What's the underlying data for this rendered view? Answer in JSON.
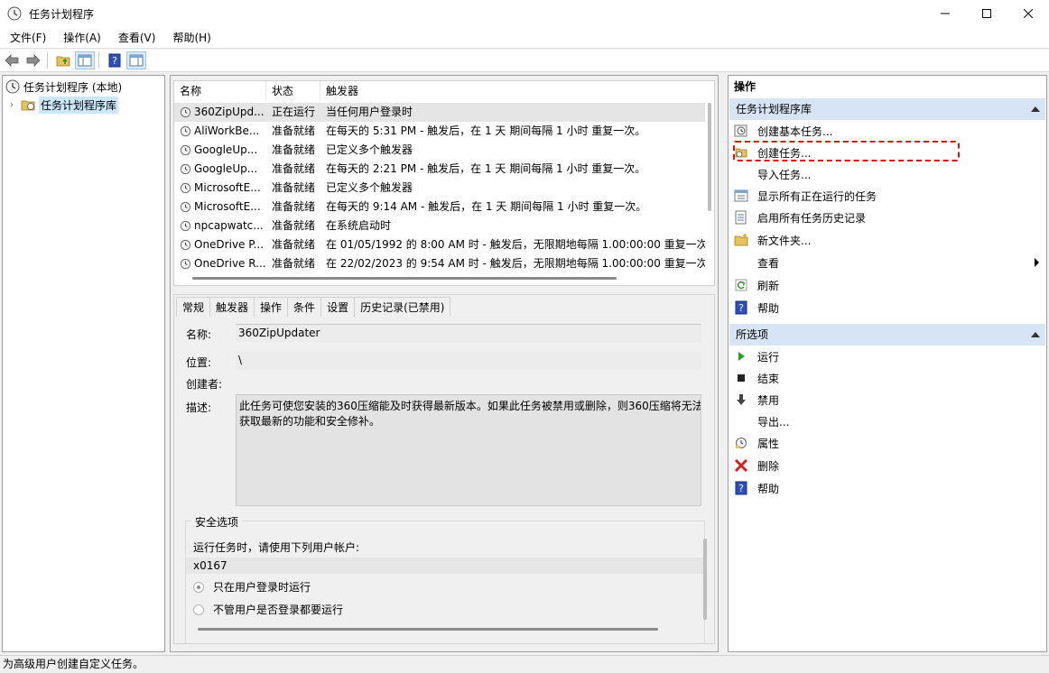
{
  "window": {
    "title": "任务计划程序"
  },
  "menu": [
    "文件(F)",
    "操作(A)",
    "查看(V)",
    "帮助(H)"
  ],
  "tree": {
    "root": "任务计划程序 (本地)",
    "library": "任务计划程序库"
  },
  "tasklist": {
    "columns": [
      "名称",
      "状态",
      "触发器"
    ],
    "rows": [
      {
        "name": "360ZipUpd...",
        "status": "正在运行",
        "trigger": "当任何用户登录时"
      },
      {
        "name": "AliWorkBe...",
        "status": "准备就绪",
        "trigger": "在每天的 5:31 PM - 触发后，在 1 天 期间每隔 1 小时 重复一次。"
      },
      {
        "name": "GoogleUp...",
        "status": "准备就绪",
        "trigger": "已定义多个触发器"
      },
      {
        "name": "GoogleUp...",
        "status": "准备就绪",
        "trigger": "在每天的 2:21 PM - 触发后，在 1 天 期间每隔 1 小时 重复一次。"
      },
      {
        "name": "MicrosoftE...",
        "status": "准备就绪",
        "trigger": "已定义多个触发器"
      },
      {
        "name": "MicrosoftE...",
        "status": "准备就绪",
        "trigger": "在每天的 9:14 AM - 触发后，在 1 天 期间每隔 1 小时 重复一次。"
      },
      {
        "name": "npcapwatc...",
        "status": "准备就绪",
        "trigger": "在系统启动时"
      },
      {
        "name": "OneDrive P...",
        "status": "准备就绪",
        "trigger": "在 01/05/1992 的 8:00 AM 时 - 触发后，无限期地每隔 1.00:00:00 重复一次。"
      },
      {
        "name": "OneDrive R...",
        "status": "准备就绪",
        "trigger": "在 22/02/2023 的 9:54 AM 时 - 触发后，无限期地每隔 1.00:00:00 重复一次。"
      }
    ]
  },
  "detail": {
    "tabs": [
      "常规",
      "触发器",
      "操作",
      "条件",
      "设置",
      "历史记录(已禁用)"
    ],
    "name_label": "名称:",
    "name_value": "360ZipUpdater",
    "location_label": "位置:",
    "location_value": "\\",
    "author_label": "创建者:",
    "desc_label": "描述:",
    "desc_line1": "此任务可使您安装的360压缩能及时获得最新版本。如果此任务被禁用或删除，则360压缩将无法",
    "desc_line2": "获取最新的功能和安全修补。",
    "security_title": "安全选项",
    "run_as_label": "运行任务时，请使用下列用户帐户:",
    "account": "x0167",
    "radio1": "只在用户登录时运行",
    "radio2": "不管用户是否登录都要运行"
  },
  "actions": {
    "header": "操作",
    "section1": "任务计划程序库",
    "items1": [
      "创建基本任务...",
      "创建任务...",
      "导入任务...",
      "显示所有正在运行的任务",
      "启用所有任务历史记录",
      "新文件夹...",
      "查看",
      "刷新",
      "帮助"
    ],
    "section2": "所选项",
    "items2": [
      "运行",
      "结束",
      "禁用",
      "导出...",
      "属性",
      "删除",
      "帮助"
    ]
  },
  "statusbar": "为高级用户创建自定义任务。",
  "colors": {
    "selection": "#cce8ff",
    "section_header": "#d6e4f5",
    "highlight": "#e01010"
  }
}
